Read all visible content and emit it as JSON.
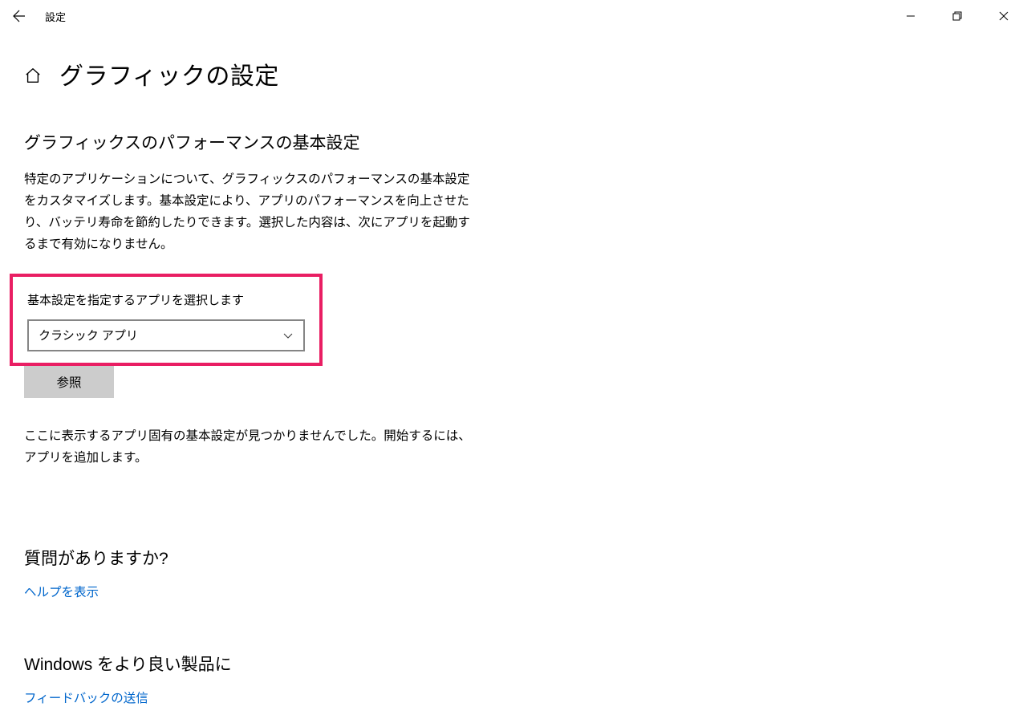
{
  "window": {
    "title": "設定"
  },
  "page": {
    "title": "グラフィックの設定"
  },
  "main": {
    "section_title": "グラフィックスのパフォーマンスの基本設定",
    "description": "特定のアプリケーションについて、グラフィックスのパフォーマンスの基本設定をカスタマイズします。基本設定により、アプリのパフォーマンスを向上させたり、バッテリ寿命を節約したりできます。選択した内容は、次にアプリを起動するまで有効になりません。",
    "dropdown_label": "基本設定を指定するアプリを選択します",
    "dropdown_value": "クラシック アプリ",
    "browse_button": "参照",
    "status_text": "ここに表示するアプリ固有の基本設定が見つかりませんでした。開始するには、アプリを追加します。"
  },
  "help": {
    "heading": "質問がありますか?",
    "link": "ヘルプを表示"
  },
  "feedback": {
    "heading": "Windows をより良い製品に",
    "link": "フィードバックの送信"
  }
}
